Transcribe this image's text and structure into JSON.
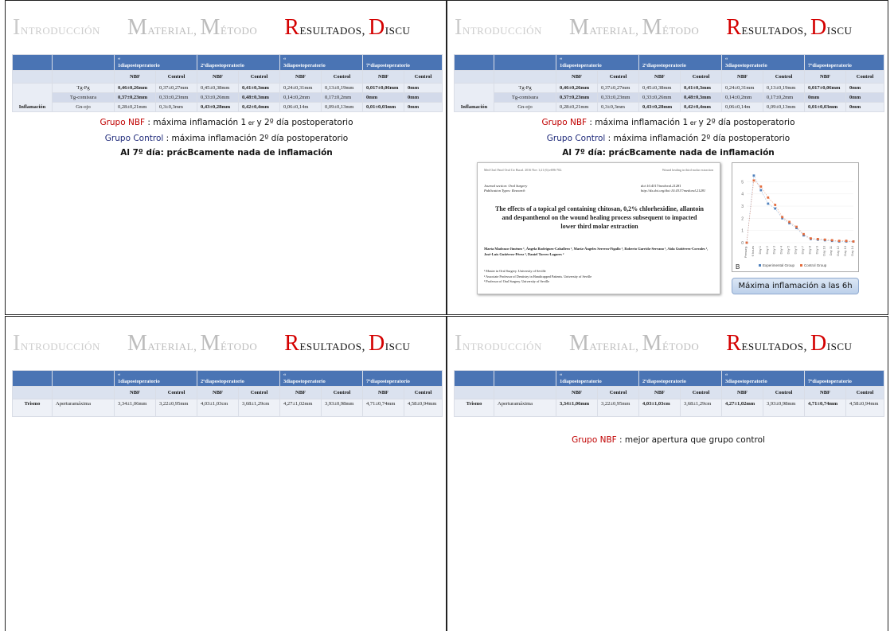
{
  "header": {
    "w1_cap": "I",
    "w1_rest": "NTRODUCCIÓN",
    "w2_cap": "M",
    "w2_rest": "ATERIAL",
    "w3_cap": "M",
    "w3_rest": "ÉTODO",
    "w4_cap": "R",
    "w4_rest": "ESULTADOS",
    "w5_cap": "D",
    "w5_rest": "ISCU",
    "sep": ","
  },
  "table_header": {
    "cols": [
      "“\n1diapostoperatorio",
      "2ºdiapostoperatorio",
      "“\n3diapostoperatorio",
      "7ºdiapostoperatorio"
    ],
    "sub": [
      "NBF",
      "Control",
      "NBF",
      "Control",
      "NBF",
      "Control",
      "NBF",
      "Control"
    ]
  },
  "inflammation": {
    "group": "Inflamación",
    "rows": [
      {
        "label": "Tg-Pg",
        "v": [
          "0,46±0,26mm",
          "0,37±0,27mm",
          "0,45±0,38mm",
          "0,41±0,3mm",
          "0,24±0,31mm",
          "0,13±0,19mm",
          "0,017±0,06mm",
          "0mm"
        ]
      },
      {
        "label": "Tg-comisura",
        "v": [
          "0,37±0,23mm",
          "0,33±0,23mm",
          "0,33±0,26mm",
          "0,48±0,3mm",
          "0,14±0,2mm",
          "0,17±0,2mm",
          "0mm",
          "0mm"
        ]
      },
      {
        "label": "Gn-ojo",
        "v": [
          "0,28±0,21mm",
          "0,3±0,3mm",
          "0,43±0,28mm",
          "0,42±0,4mm",
          "0,06±0,14m",
          "0,09±0,13mm",
          "0,01±0,03mm",
          "0mm"
        ]
      }
    ]
  },
  "trismo": {
    "group": "Trismo",
    "label": "Aperturamáxima",
    "v": [
      "3,34±1,06mm",
      "3,22±0,95mm",
      "4,03±1,03cm",
      "3,68±1,29cm",
      "4,27±1,02mm",
      "3,93±0,98mm",
      "4,71±0,74mm",
      "4,58±0,94mm"
    ]
  },
  "summary": {
    "nbf_label": "Grupo NBF",
    "nbf_text": " : máxima inflamación 1",
    "nbf_sup": " er ",
    "nbf_text2": " y 2º día postoperatorio",
    "ctrl_label": "Grupo Control",
    "ctrl_text": " : máxima inflamación 2º día postoperatorio",
    "day7": "Al 7º día: prácBcamente nada de inflamación"
  },
  "article": {
    "meta_left": "Med Oral Patol Oral Cir Bucal. 2016 Nov 1;21 (6):e696-702.",
    "meta_right": "Wound healing in third molar extraction",
    "section": "Journal section: Oral Surgery",
    "pubtype": "Publication Types: Research",
    "doi1": "doi:10.4317/medoral.21281",
    "doi2": "http://dx.doi.org/doi:10.4317/medoral.21281",
    "title": "The effects of a topical gel containing chitosan, 0,2% chlorhexidine, allantoin and despanthenol on the wound healing process subsequent to impacted lower third molar extraction",
    "authors": "Marta Madrazo-Jiménez ¹, Ángela Rodríguez-Caballero ², María-Ángeles Serrera-Figallo ², Roberto Garrido-Serrano ¹, Aida Gutiérrez-Corrales ¹, José-Luis Gutiérrez-Pérez ³, Daniel Torres-Lagares ²",
    "affil1": "¹ Master in Oral Surgery. University of Seville",
    "affil2": "² Associate Professor of Dentistry in Handicapped Patients. University of Seville",
    "affil3": "³ Professor of Oral Surgery. University of Seville"
  },
  "chart_data": {
    "type": "line",
    "categories": [
      "Presurg.",
      "6 hours",
      "Day 1",
      "Day 2",
      "Day 3",
      "Day 4",
      "Day 5",
      "Day 6",
      "Day 7",
      "Day 8",
      "Day 9",
      "Day 10",
      "Day 11",
      "Day 12",
      "Day 13",
      "Day 14"
    ],
    "series": [
      {
        "name": "Experimental Group",
        "values": [
          0,
          5.5,
          4.3,
          3.2,
          2.8,
          2.0,
          1.6,
          1.2,
          0.6,
          0.3,
          0.25,
          0.2,
          0.15,
          0.1,
          0.1,
          0.1
        ],
        "color": "#4f81bd"
      },
      {
        "name": "Control Group",
        "values": [
          0,
          5.1,
          4.6,
          3.7,
          3.1,
          2.1,
          1.7,
          1.3,
          0.7,
          0.35,
          0.3,
          0.25,
          0.2,
          0.15,
          0.15,
          0.1
        ],
        "color": "#e46c3d"
      }
    ],
    "ylim": [
      0,
      6
    ],
    "yticks": [
      "0",
      "1",
      "2",
      "3",
      "4",
      "5"
    ],
    "panel_label": "B"
  },
  "callout": "Máxima inflamación a las 6h",
  "trismo_summary": {
    "nbf_label": "Grupo NBF",
    "text": " : mejor apertura que grupo control"
  },
  "colors": {
    "accent_red": "#c00000",
    "navy": "#1f2a7a",
    "table_header": "#4a74b4"
  }
}
